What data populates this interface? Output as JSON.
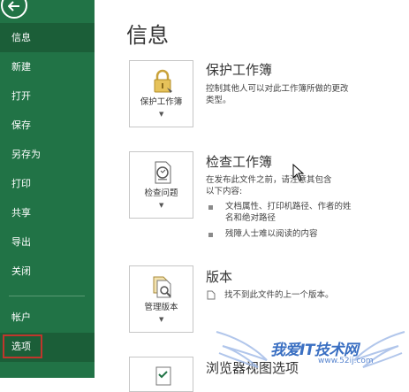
{
  "sidebar": {
    "items": [
      {
        "label": "信息"
      },
      {
        "label": "新建"
      },
      {
        "label": "打开"
      },
      {
        "label": "保存"
      },
      {
        "label": "另存为"
      },
      {
        "label": "打印"
      },
      {
        "label": "共享"
      },
      {
        "label": "导出"
      },
      {
        "label": "关闭"
      },
      {
        "label": "帐户"
      },
      {
        "label": "选项"
      }
    ]
  },
  "main": {
    "title": "信息",
    "sections": [
      {
        "card_label": "保护工作簿",
        "title": "保护工作簿",
        "desc_lines": [
          "控制其他人可以对此工作簿所做的更改",
          "类型。"
        ]
      },
      {
        "card_label": "检查问题",
        "title": "检查工作簿",
        "desc_lines": [
          "在发布此文件之前，请注意其包含",
          "以下内容:"
        ],
        "bullets": [
          [
            "文档属性、打印机路径、作者的姓",
            "名和绝对路径"
          ],
          [
            "残障人士难以阅读的内容"
          ]
        ]
      },
      {
        "card_label": "管理版本",
        "title": "版本",
        "desc_lines": [
          "找不到此文件的上一个版本。"
        ]
      },
      {
        "title": "浏览器视图选项"
      }
    ]
  },
  "watermark": {
    "text": "我爱IT技术网",
    "url": "www.52ij.com"
  },
  "colors": {
    "sidebar_bg": "#217346",
    "sidebar_active": "#1b5e38",
    "highlight_border": "#c0362c"
  }
}
